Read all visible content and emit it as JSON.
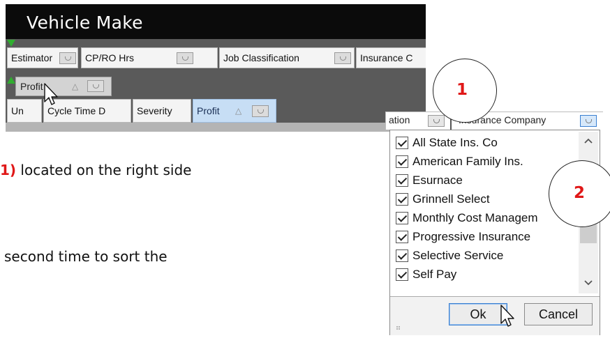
{
  "grid": {
    "title": "Vehicle Make",
    "group_headers": [
      "Estimator",
      "CP/RO Hrs",
      "Job Classification",
      "Insurance C"
    ],
    "dragged_column": "Profit",
    "columns": [
      "Un",
      "Cycle Time D",
      "Severity",
      "Profit"
    ],
    "sort_glyph": "△"
  },
  "instructions": {
    "line1_prefix": "1)",
    "line1_text": " located on the right side",
    "line2_text": "second time to sort the"
  },
  "callouts": {
    "one": "1",
    "two": "2"
  },
  "filter_popup": {
    "header_left": "ation",
    "header_right": "Insurance Company",
    "items": [
      {
        "label": "All State Ins. Co",
        "checked": true
      },
      {
        "label": "American Family Ins.",
        "checked": true
      },
      {
        "label": "Esurnace",
        "checked": true
      },
      {
        "label": "Grinnell Select",
        "checked": true
      },
      {
        "label": "Monthly Cost Managem",
        "checked": true
      },
      {
        "label": "Progressive Insurance",
        "checked": true
      },
      {
        "label": "Selective Service",
        "checked": true
      },
      {
        "label": "Self Pay",
        "checked": true
      }
    ],
    "ok_label": "Ok",
    "cancel_label": "Cancel"
  },
  "icons": {
    "scroll_up": "chevron-up-icon",
    "scroll_down": "chevron-down-icon",
    "filter": "filter-dropdown-icon",
    "cursor": "mouse-pointer-icon",
    "move_arrows": "green-arrow-icon"
  },
  "colors": {
    "title_bar": "#0b0b0b",
    "selected_column": "#c7def5",
    "callout_number": "#e01818",
    "arrow": "#2fae2f"
  }
}
